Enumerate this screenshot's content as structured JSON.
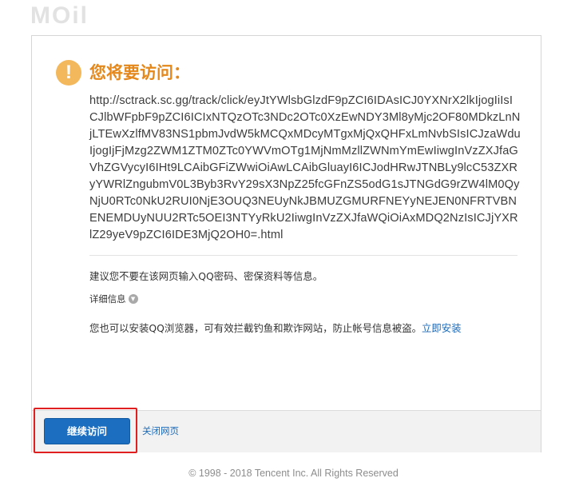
{
  "header": {
    "logo_text": "MOil"
  },
  "warning": {
    "icon": "exclamation-icon",
    "title": "您将要访问：",
    "url": "http://sctrack.sc.gg/track/click/eyJtYWlsbGlzdF9pZCI6IDAsICJ0YXNrX2lkIjogIiIsICJlbWFpbF9pZCI6ICIxNTQzOTc3NDc2OTc0XzEwNDY3Ml8yMjc2OF80MDkzLnNjLTEwXzlfMV83NS1pbmJvdW5kMCQxMDcyMTgxMjQxQHFxLmNvbSIsICJzaWduIjogIjFjMzg2ZWM1ZTM0ZTc0YWVmOTg1MjNmMzllZWNmYmEwIiwgInVzZXJfaGVhZGVycyI6IHt9LCAibGFiZWwiOiAwLCAibGluayI6ICJodHRwJTNBLy9lcC53ZXRyYWRlZngubmV0L3Byb3RvY29sX3NpZ25fcGFnZS5odG1sJTNGdG9rZW4lM0QyNjU0RTc0NkU2RUI0NjE3OUQ3NEUyNkJBMUZGMURFNEYyNEJEN0NFRTVBNENEMDUyNUU2RTc5OEI3NTYyRkU2IiwgInVzZXJfaWQiOiAxMDQ2NzIsICJjYXRlZ29yeV9pZCI6IDE3MjQ2OH0=.html"
  },
  "advice": "建议您不要在该网页输入QQ密码、密保资料等信息。",
  "details": {
    "label": "详细信息",
    "icon": "chevron-down-icon"
  },
  "install": {
    "text": "您也可以安装QQ浏览器，可有效拦截钓鱼和欺诈网站，防止帐号信息被盗。",
    "link": "立即安装"
  },
  "actions": {
    "continue_label": "继续访问",
    "close_label": "关闭网页"
  },
  "footer": {
    "copyright": "© 1998 - 2018 Tencent Inc. All Rights Reserved"
  },
  "colors": {
    "title": "#e5881b",
    "warning_icon": "#f3b85c",
    "primary_button": "#1c6ec0",
    "link": "#1a6aba",
    "highlight_border": "#e02020"
  }
}
